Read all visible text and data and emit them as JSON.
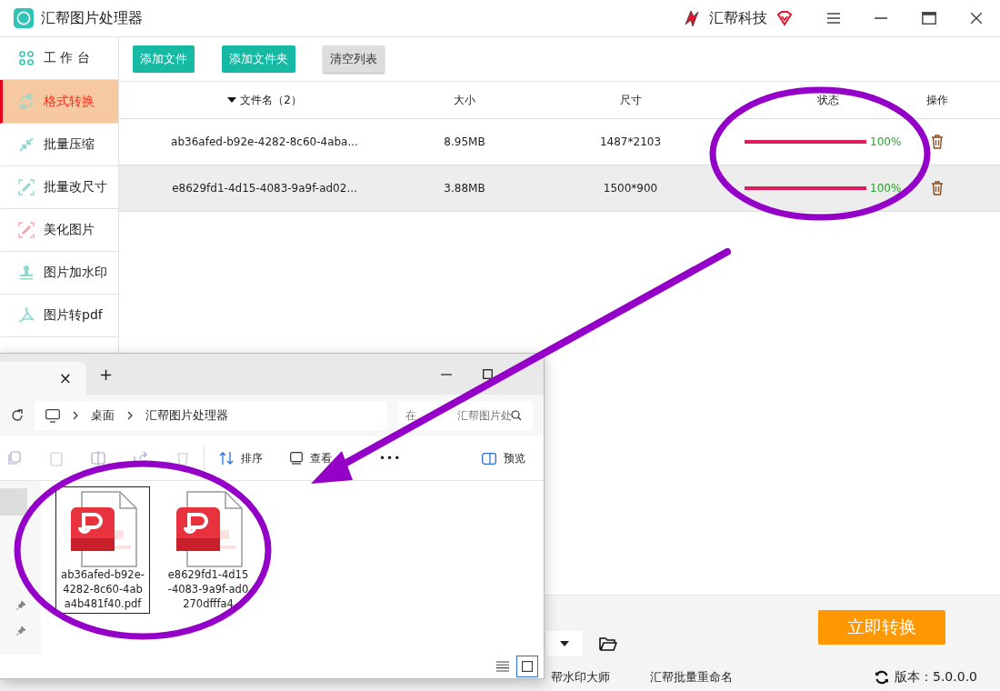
{
  "window": {
    "title": "汇帮图片处理器",
    "brand": "汇帮科技"
  },
  "sidebar": {
    "items": [
      {
        "label": "工 作 台",
        "selected": false,
        "kind": "grid"
      },
      {
        "label": "格式转换",
        "selected": true,
        "kind": "convert"
      },
      {
        "label": "批量压缩",
        "selected": false,
        "kind": "compress"
      },
      {
        "label": "批量改尺寸",
        "selected": false,
        "kind": "resize"
      },
      {
        "label": "美化图片",
        "selected": false,
        "kind": "beautify"
      },
      {
        "label": "图片加水印",
        "selected": false,
        "kind": "stamp"
      },
      {
        "label": "图片转pdf",
        "selected": false,
        "kind": "pdf"
      }
    ]
  },
  "toolbar": {
    "buttons": [
      {
        "label": "添加文件",
        "kind": "primary"
      },
      {
        "label": "添加文件夹",
        "kind": "primary"
      },
      {
        "label": "清空列表",
        "kind": "plain"
      }
    ]
  },
  "table": {
    "columns": [
      "文件名（2）",
      "大小",
      "尺寸",
      "状态",
      "操作"
    ],
    "rows": [
      {
        "name": "ab36afed-b92e-4282-8c60-4aba...",
        "size": "8.95MB",
        "dims": "1487*2103",
        "level": 1,
        "percent": "100%",
        "selected": false
      },
      {
        "name": "e8629fd1-4d15-4083-9a9f-ad02...",
        "size": "3.88MB",
        "dims": "1500*900",
        "level": 1,
        "percent": "100%",
        "selected": true
      }
    ]
  },
  "convert_button": "立即转换",
  "footer": {
    "links": [
      "帮水印大师",
      "汇帮批量重命名"
    ],
    "version": "版本：5.0.0.0"
  },
  "explorer": {
    "tab_close": "×",
    "new_tab": "+",
    "breadcrumb": [
      "桌面",
      "汇帮图片处理器"
    ],
    "search": {
      "placeholder": "在 汇帮图片处"
    },
    "toolbar": {
      "sort": "排序",
      "view": "查看",
      "more": "•••",
      "preview": "预览"
    },
    "files": [
      {
        "name": "ab36afed-b92e-4282-8c60-4aba4b481f40.pdf",
        "selected": true
      },
      {
        "name": "e8629fd1-4d15-4083-9a9f-ad0270dfffa4",
        "selected": false
      }
    ]
  }
}
